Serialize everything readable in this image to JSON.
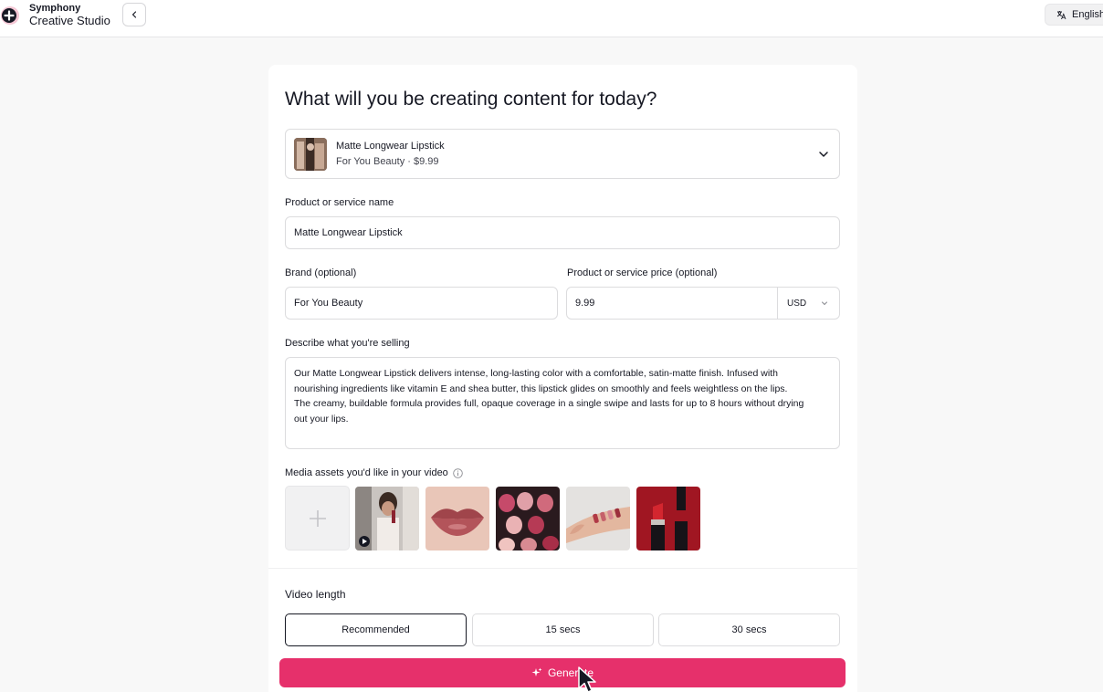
{
  "topbar": {
    "brand_name": "Symphony",
    "brand_product": "Creative Studio",
    "language_label": "English",
    "icons": [
      "symphony-logo-icon",
      "chevron-left-icon",
      "translate-icon"
    ]
  },
  "form": {
    "title": "What will you be creating content for today?",
    "selected_product": {
      "name": "Matte Longwear Lipstick",
      "subtitle": "For You Beauty · $9.99"
    },
    "product_name_label": "Product or service name",
    "product_name_value": "Matte Longwear Lipstick",
    "brand_label": "Brand (optional)",
    "brand_value": "For You Beauty",
    "price_label": "Product or service price (optional)",
    "price_value": "9.99",
    "currency_value": "USD",
    "description_label": "Describe what you're selling",
    "description_lines": [
      "Our Matte Longwear Lipstick delivers intense, long-lasting color with a comfortable, satin-matte finish. Infused with",
      "nourishing ingredients like vitamin E and shea butter, this lipstick glides on smoothly and feels weightless on the lips.",
      "The creamy, buildable formula provides full, opaque coverage in a single swipe and lasts for up to 8 hours without drying",
      "out your lips."
    ],
    "media_label": "Media assets you'd like in your video",
    "media_assets": [
      {
        "type": "video",
        "subject": "woman applying lipstick"
      },
      {
        "type": "image",
        "subject": "lips close-up"
      },
      {
        "type": "image",
        "subject": "lipstick row"
      },
      {
        "type": "image",
        "subject": "lipstick swatches on arm"
      },
      {
        "type": "image",
        "subject": "red lipstick tube"
      }
    ],
    "video_length_label": "Video length",
    "video_length_options": [
      "Recommended",
      "15 secs",
      "30 secs"
    ],
    "video_length_selected": "Recommended",
    "generate_label": "Generate"
  },
  "colors": {
    "accent": "#e6306b",
    "text": "#161823",
    "border": "#dcdcde",
    "background": "#f8f8f8"
  }
}
